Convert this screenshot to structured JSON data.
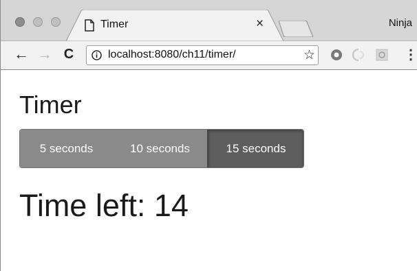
{
  "browser": {
    "tab_title": "Timer",
    "tab_close": "×",
    "profile_name": "Ninja",
    "url": "localhost:8080/ch11/timer/",
    "icons": {
      "back": "arrow-left-icon",
      "forward": "arrow-right-icon",
      "reload": "reload-icon",
      "info": "info-icon",
      "bookmark": "star-icon",
      "menu": "menu-dots-icon"
    }
  },
  "page": {
    "title": "Timer",
    "buttons": [
      {
        "label": "5 seconds",
        "active": false
      },
      {
        "label": "10 seconds",
        "active": false
      },
      {
        "label": "15 seconds",
        "active": true
      }
    ],
    "time_left_label": "Time left:",
    "time_left_value": "14"
  },
  "colors": {
    "button_default": "#8a8a8a",
    "button_active": "#5e5e5e",
    "text": "#1a1a1a"
  }
}
